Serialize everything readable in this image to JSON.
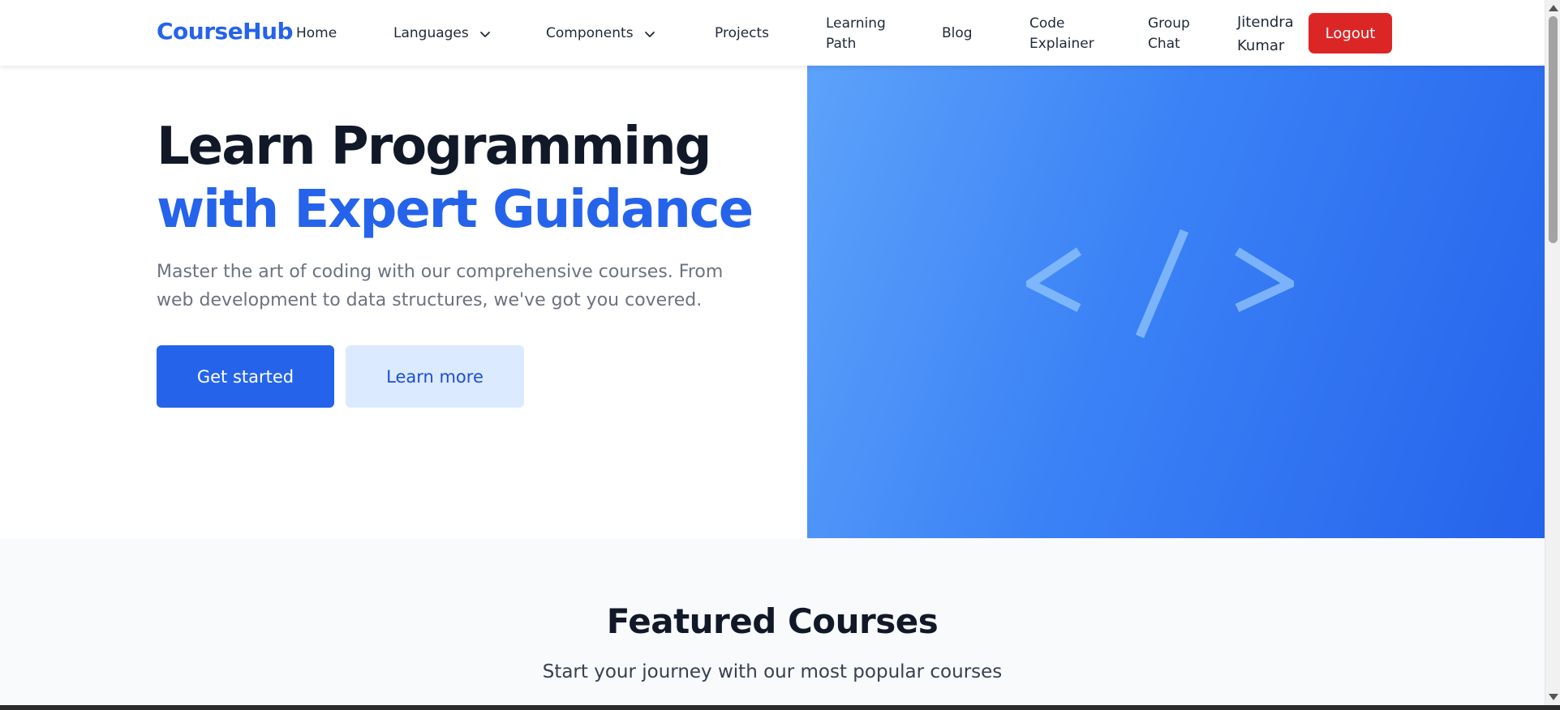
{
  "navbar": {
    "brand": "CourseHub",
    "items": [
      {
        "label": "Home"
      },
      {
        "label": "Languages"
      },
      {
        "label": "Components"
      },
      {
        "label": "Projects"
      },
      {
        "label": "Learning Path"
      },
      {
        "label": "Blog"
      },
      {
        "label": "Code Explainer"
      },
      {
        "label": "Group Chat"
      }
    ],
    "user_name": "Jitendra Kumar",
    "logout_label": "Logout"
  },
  "hero": {
    "title_line1": "Learn Programming",
    "title_line2": "with Expert Guidance",
    "subtitle": "Master the art of coding with our comprehensive courses. From web development to data structures, we've got you covered.",
    "primary_button": "Get started",
    "secondary_button": "Learn more",
    "icon": "code-brackets-icon"
  },
  "featured": {
    "title": "Featured Courses",
    "subtitle": "Start your journey with our most popular courses"
  },
  "colors": {
    "brand": "#2563eb",
    "logout": "#dc2626",
    "secondary_bg": "#dbeafe",
    "gradient_start": "#60a5fa",
    "gradient_end": "#2563eb"
  }
}
